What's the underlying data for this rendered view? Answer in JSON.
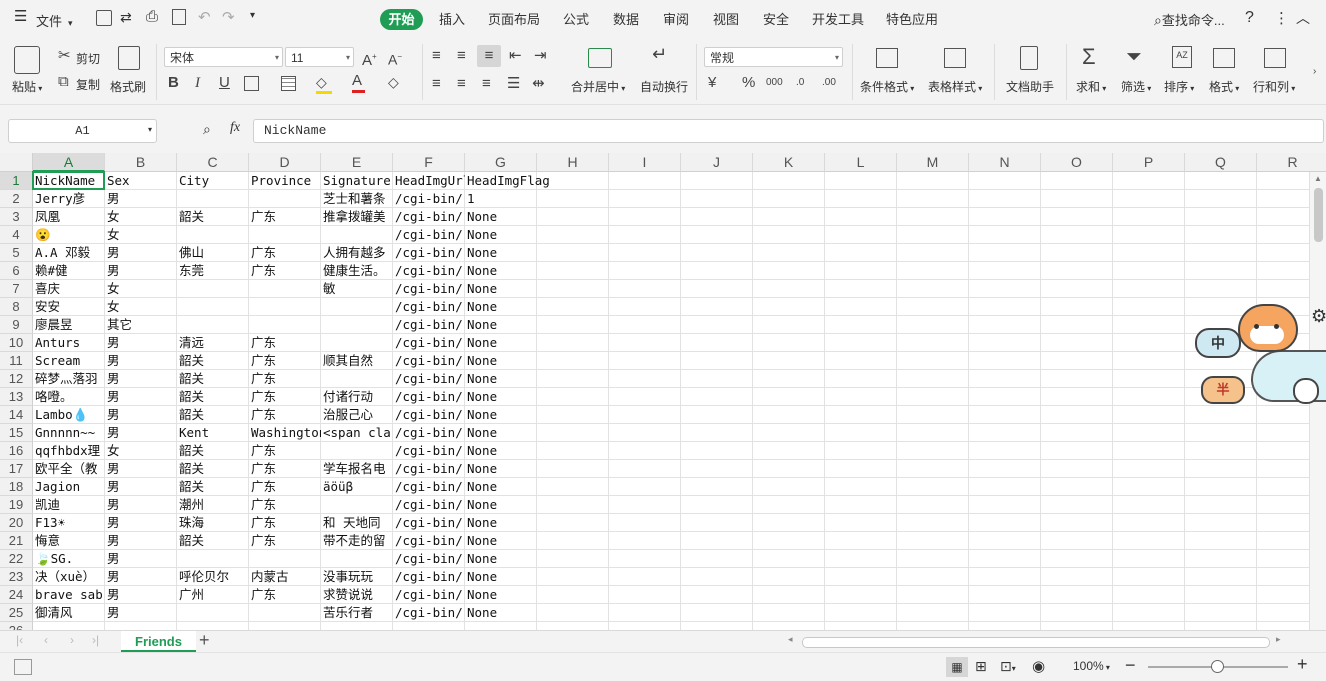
{
  "menu": {
    "file": "文件",
    "tabs": [
      "开始",
      "插入",
      "页面布局",
      "公式",
      "数据",
      "审阅",
      "视图",
      "安全",
      "开发工具",
      "特色应用"
    ],
    "active_tab": "开始",
    "search": "查找命令...",
    "help": "?"
  },
  "ribbon": {
    "paste": "粘贴",
    "cut": "剪切",
    "copy": "复制",
    "format_painter": "格式刷",
    "font_name": "宋体",
    "font_size": "11",
    "bold": "B",
    "italic": "I",
    "underline": "U",
    "number_format": "常规",
    "merge_center": "合并居中",
    "wrap_text": "自动换行",
    "percent": "%",
    "thousands": "000",
    "conditional_format": "条件格式",
    "table_style": "表格样式",
    "doc_assistant": "文档助手",
    "sum": "求和",
    "filter": "筛选",
    "sort": "排序",
    "format": "格式",
    "rows_cols": "行和列"
  },
  "formula_bar": {
    "cell_ref": "A1",
    "fx": "fx",
    "content": "NickName"
  },
  "grid": {
    "columns": [
      "A",
      "B",
      "C",
      "D",
      "E",
      "F",
      "G",
      "H",
      "I",
      "J",
      "K",
      "L",
      "M",
      "N",
      "O",
      "P",
      "Q",
      "R"
    ],
    "selected_column": "A",
    "row_numbers": [
      "1",
      "2",
      "3",
      "4",
      "5",
      "6",
      "7",
      "8",
      "9",
      "10",
      "11",
      "12",
      "13",
      "14",
      "15",
      "16",
      "17",
      "18",
      "19",
      "20",
      "21",
      "22",
      "23",
      "24",
      "25",
      "26"
    ],
    "rows": [
      [
        "NickName",
        "Sex",
        "City",
        "Province",
        "Signature",
        "HeadImgUrl",
        "HeadImgFlag"
      ],
      [
        "Jerry彦",
        "男",
        "",
        "",
        "芝士和薯条",
        "/cgi-bin/",
        "1"
      ],
      [
        "凤凰",
        "女",
        "韶关",
        "广东",
        "推拿拨罐美",
        "/cgi-bin/",
        "None"
      ],
      [
        "😮",
        "女",
        "",
        "",
        "",
        "/cgi-bin/",
        "None"
      ],
      [
        "A.A 邓毅",
        "男",
        "佛山",
        "广东",
        "人拥有越多",
        "/cgi-bin/",
        "None"
      ],
      [
        "赖#健",
        "男",
        "东莞",
        "广东",
        "健康生活。",
        "/cgi-bin/",
        "None"
      ],
      [
        "喜庆",
        "女",
        "",
        "",
        "敏",
        "/cgi-bin/",
        "None"
      ],
      [
        "安安",
        "女",
        "",
        "",
        "",
        "/cgi-bin/",
        "None"
      ],
      [
        "廖晨昱",
        "其它",
        "",
        "",
        "",
        "/cgi-bin/",
        "None"
      ],
      [
        "Anturs",
        "男",
        "清远",
        "广东",
        "",
        "/cgi-bin/",
        "None"
      ],
      [
        "Scream",
        "男",
        "韶关",
        "广东",
        "顺其自然",
        "/cgi-bin/",
        "None"
      ],
      [
        "碎梦灬落羽",
        "男",
        "韶关",
        "广东",
        "",
        "/cgi-bin/",
        "None"
      ],
      [
        "咯噔。",
        "男",
        "韶关",
        "广东",
        "付诸行动",
        "/cgi-bin/",
        "None"
      ],
      [
        "Lambo💧",
        "男",
        "韶关",
        "广东",
        "治服己心",
        "/cgi-bin/",
        "None"
      ],
      [
        "Gnnnnn~~",
        "男",
        "Kent",
        "Washington",
        "<span cla",
        "/cgi-bin/",
        "None"
      ],
      [
        "qqfhbdx理",
        "女",
        "韶关",
        "广东",
        "",
        "/cgi-bin/",
        "None"
      ],
      [
        "欧平全（教",
        "男",
        "韶关",
        "广东",
        "学车报名电",
        "/cgi-bin/",
        "None"
      ],
      [
        "Jagion",
        "男",
        "韶关",
        "广东",
        "äöüβ",
        "/cgi-bin/",
        "None"
      ],
      [
        "凯迪",
        "男",
        "潮州",
        "广东",
        "",
        "/cgi-bin/",
        "None"
      ],
      [
        "F13☀",
        "男",
        "珠海",
        "广东",
        "和 天地同",
        "/cgi-bin/",
        "None"
      ],
      [
        "悔意",
        "男",
        "韶关",
        "广东",
        "带不走的留",
        "/cgi-bin/",
        "None"
      ],
      [
        "🍃SG.",
        "男",
        "",
        "",
        "",
        "/cgi-bin/",
        "None"
      ],
      [
        "决（xuè）",
        "男",
        "呼伦贝尔",
        "内蒙古",
        "没事玩玩",
        "/cgi-bin/",
        "None"
      ],
      [
        "brave sab",
        "男",
        "广州",
        "广东",
        "求赞说说",
        "/cgi-bin/",
        "None"
      ],
      [
        "御清风",
        "男",
        "",
        "",
        "苦乐行者",
        "/cgi-bin/",
        "None"
      ],
      [
        "",
        "",
        "",
        "",
        "",
        "",
        ""
      ]
    ]
  },
  "sheet_tabs": [
    "Friends"
  ],
  "status": {
    "zoom": "100%"
  },
  "mascot": {
    "top_badge": "中",
    "bottom_badge": "半"
  },
  "colors": {
    "accent": "#1f9d55",
    "toolbar_bg": "#f3f3f3",
    "grid_line": "#e2e2e2"
  }
}
